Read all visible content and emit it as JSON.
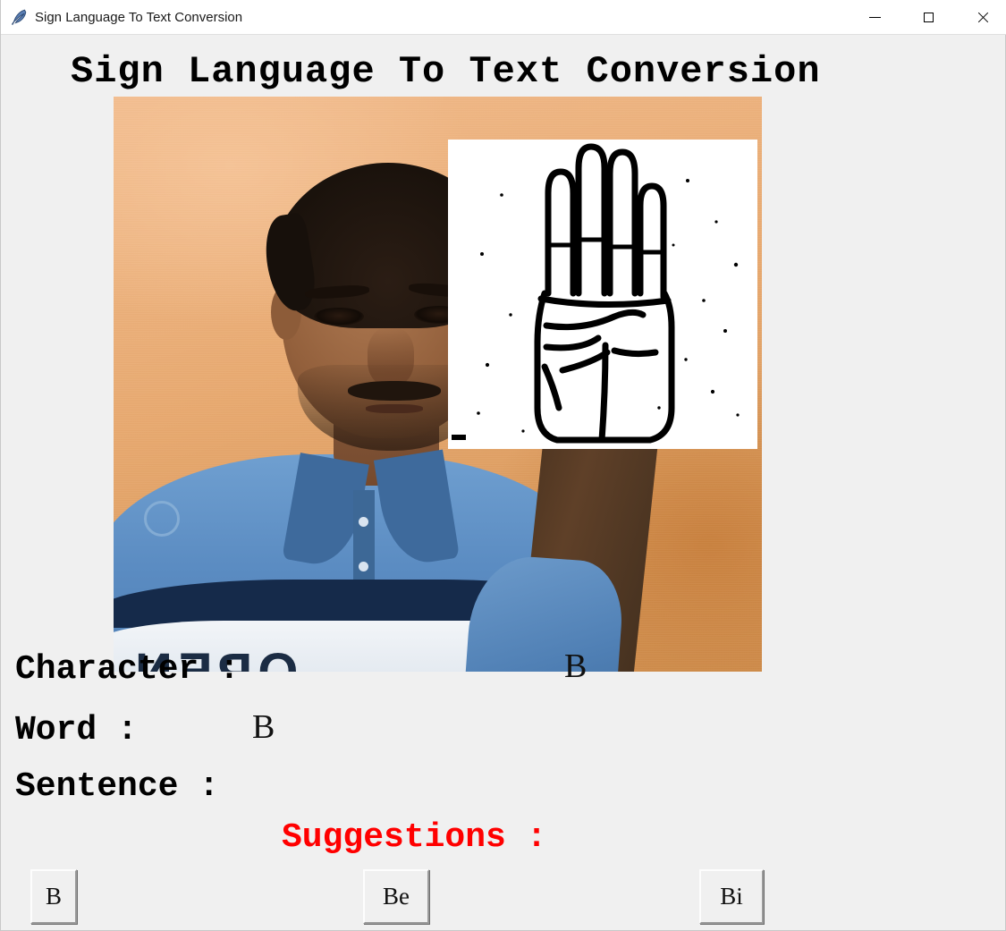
{
  "window": {
    "title": "Sign Language To Text Conversion",
    "icon": "feather-icon",
    "background_color": "#f0f0f0",
    "controls": {
      "minimize": "minimize-icon",
      "maximize": "maximize-icon",
      "close": "close-icon"
    }
  },
  "heading": {
    "text": "Sign Language To Text Conversion",
    "color": "#000000"
  },
  "video": {
    "alt": "live-webcam-feed",
    "wall_color": "#e8a96f",
    "shirt_color": "#4f7fb4",
    "shirt_print": "OPEN"
  },
  "roi": {
    "alt": "thresholded-hand-roi",
    "background_color": "#ffffff",
    "ink_color": "#000000"
  },
  "fields": {
    "character_label": "Character :",
    "character_value": "B",
    "word_label": "Word :",
    "word_value": "B",
    "sentence_label": "Sentence :",
    "sentence_value": ""
  },
  "suggestions": {
    "label": "Suggestions :",
    "label_color": "#ff0000",
    "buttons": [
      {
        "label": "B"
      },
      {
        "label": "Be"
      },
      {
        "label": "Bi"
      }
    ]
  }
}
